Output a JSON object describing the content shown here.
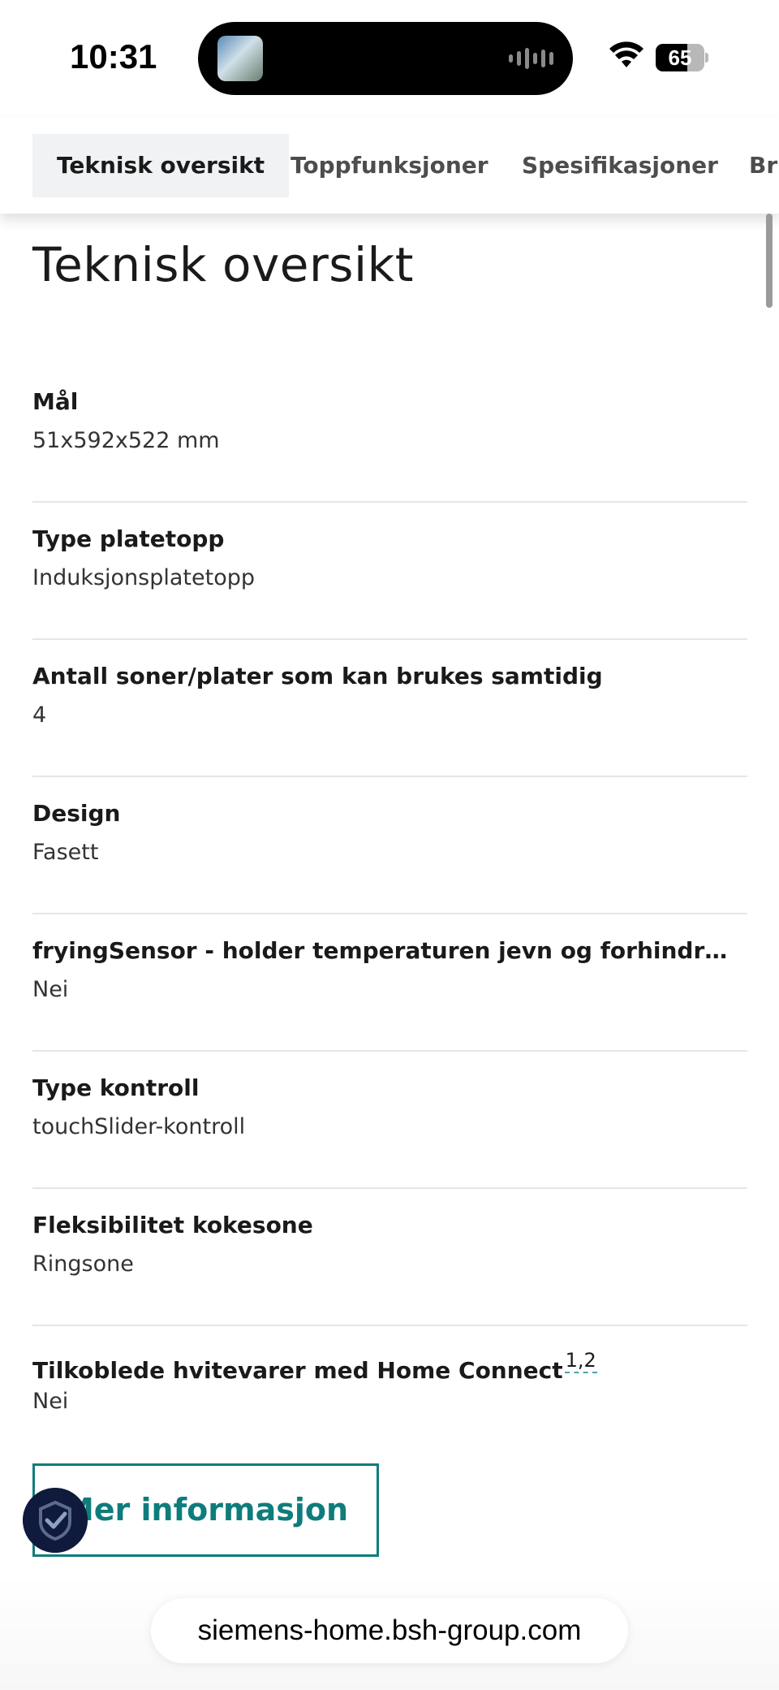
{
  "status_bar": {
    "time": "10:31",
    "battery_level": "65",
    "icons": [
      "wifi-icon",
      "battery-icon",
      "now-playing-artwork",
      "audio-waveform-icon"
    ]
  },
  "tabs": [
    {
      "label": "Teknisk oversikt",
      "active": true
    },
    {
      "label": "Toppfunksjoner",
      "active": false
    },
    {
      "label": "Spesifikasjoner",
      "active": false
    },
    {
      "label": "Bru",
      "active": false
    }
  ],
  "page": {
    "title": "Teknisk oversikt"
  },
  "specs": [
    {
      "label": "Mål",
      "value": "51x592x522 mm"
    },
    {
      "label": "Type platetopp",
      "value": "Induksjonsplatetopp"
    },
    {
      "label": "Antall soner/plater som kan brukes samtidig",
      "value": "4"
    },
    {
      "label": "Design",
      "value": "Fasett"
    },
    {
      "label": "fryingSensor - holder temperaturen jevn og forhindrer at mat brenner seg",
      "value": "Nei"
    },
    {
      "label": "Type kontroll",
      "value": "touchSlider-kontroll"
    },
    {
      "label": "Fleksibilitet kokesone",
      "value": "Ringsone"
    },
    {
      "label": "Tilkoblede hvitevarer med Home Connect",
      "footnote": "1,2",
      "value": "Nei"
    }
  ],
  "more_button": {
    "label": "Mer informasjon"
  },
  "browser": {
    "url": "siemens-home.bsh-group.com"
  },
  "colors": {
    "accent": "#0f7c7c",
    "divider": "#e6e6e6",
    "active_tab_bg": "#f0f2f4"
  }
}
